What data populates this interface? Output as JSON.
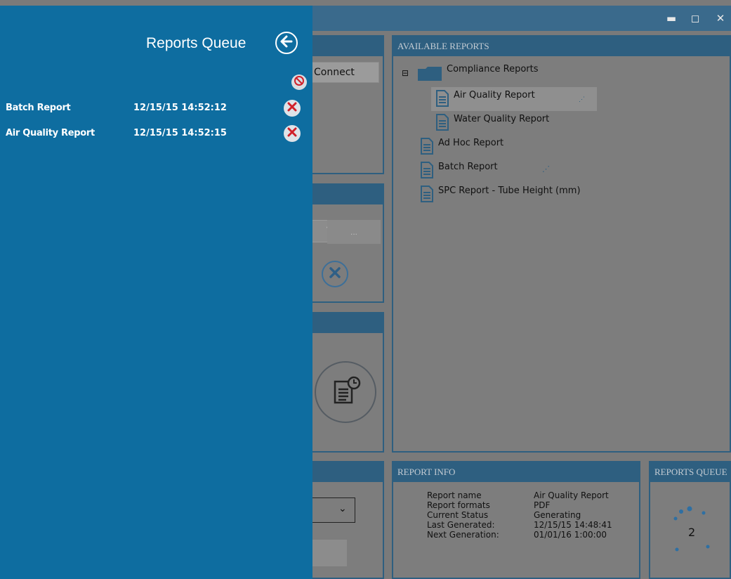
{
  "window": {
    "minimize_glyph": "▬",
    "maximize_glyph": "◻",
    "close_glyph": "✕"
  },
  "background": {
    "connect_button_label": "Connect",
    "ellipsis_button_label": "...",
    "available_reports": {
      "header": "AVAILABLE REPORTS",
      "tree": {
        "expand_glyph": "⊟",
        "folder_label": "Compliance Reports",
        "folder_children": [
          "Air Quality Report",
          "Water Quality Report"
        ],
        "items": [
          "Ad Hoc Report",
          "Batch Report",
          "SPC Report - Tube Height (mm)"
        ],
        "selected": "Air Quality Report"
      }
    },
    "report_info": {
      "header": "REPORT INFO",
      "rows": [
        {
          "label": "Report name",
          "value": "Air Quality Report"
        },
        {
          "label": "Report formats",
          "value": "PDF"
        },
        {
          "label": "Current Status",
          "value": "Generating"
        },
        {
          "label": "Last Generated:",
          "value": "12/15/15 14:48:41"
        },
        {
          "label": "Next Generation:",
          "value": "01/01/16 1:00:00"
        }
      ]
    },
    "reports_queue_panel": {
      "header": "REPORTS QUEUE",
      "count": "2"
    }
  },
  "flyout": {
    "title": "Reports Queue",
    "items": [
      {
        "name": "Batch Report",
        "time": "12/15/15 14:52:12"
      },
      {
        "name": "Air Quality Report",
        "time": "12/15/15 14:52:15"
      }
    ]
  },
  "colors": {
    "flyout_bg": "#0e6da0",
    "panel_header": "#2e5f80",
    "dim_bg": "#7a7a7a",
    "remove_x": "#d0202a"
  }
}
